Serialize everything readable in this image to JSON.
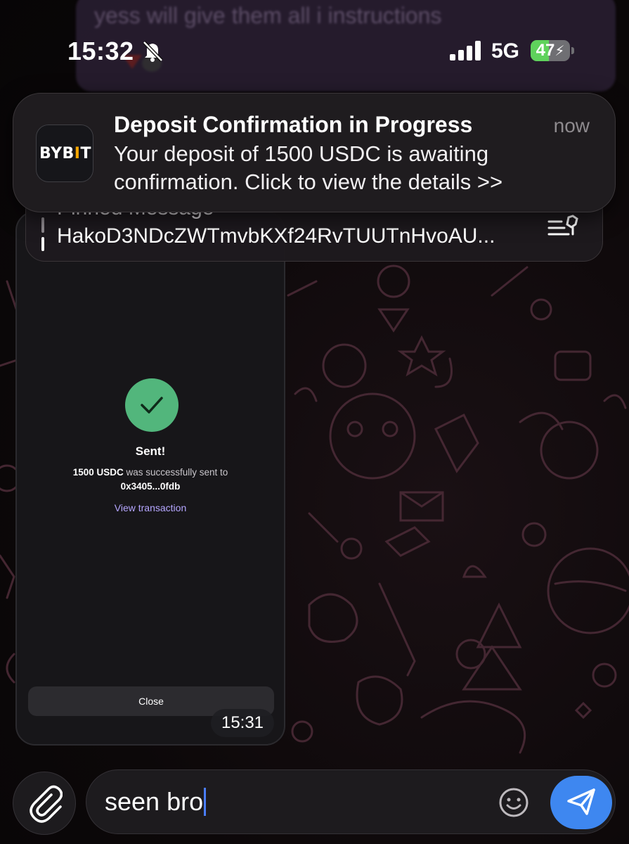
{
  "status_bar": {
    "time": "15:32",
    "network": "5G",
    "battery_percent": 47,
    "battery_label": "47",
    "silent_icon": "bell-slash-icon",
    "signal_icon": "cellular-signal-icon"
  },
  "chat_background": {
    "previous_message_text": "yess will give them all i instructions"
  },
  "notification": {
    "app_icon_text": "BYB",
    "app_icon_accent": "I",
    "app_icon_tail": "T",
    "title": "Deposit Confirmation in Progress",
    "time": "now",
    "body": "Your deposit of 1500 USDC is awaiting confirmation. Click to view the details >>"
  },
  "pinned": {
    "title": "Pinned Message",
    "text": "HakoD3NDcZWTmvbKXf24RvTUUTnHvoAU...",
    "list_icon": "pinned-list-icon"
  },
  "message": {
    "status_icon": "check-icon",
    "sent_title": "Sent!",
    "amount": "1500 USDC",
    "sent_text": " was successfully sent to",
    "address": "0x3405...0fdb",
    "view_link": "View transaction",
    "close_label": "Close",
    "time": "15:31"
  },
  "composer": {
    "attach_icon": "paperclip-icon",
    "input_value": "seen bro",
    "emoji_icon": "emoji-icon",
    "send_icon": "send-icon"
  },
  "colors": {
    "accent_blue": "#3e87f0",
    "success_green": "#52b67c",
    "link_purple": "#b5a6ff",
    "bybit_orange": "#f7a600"
  }
}
